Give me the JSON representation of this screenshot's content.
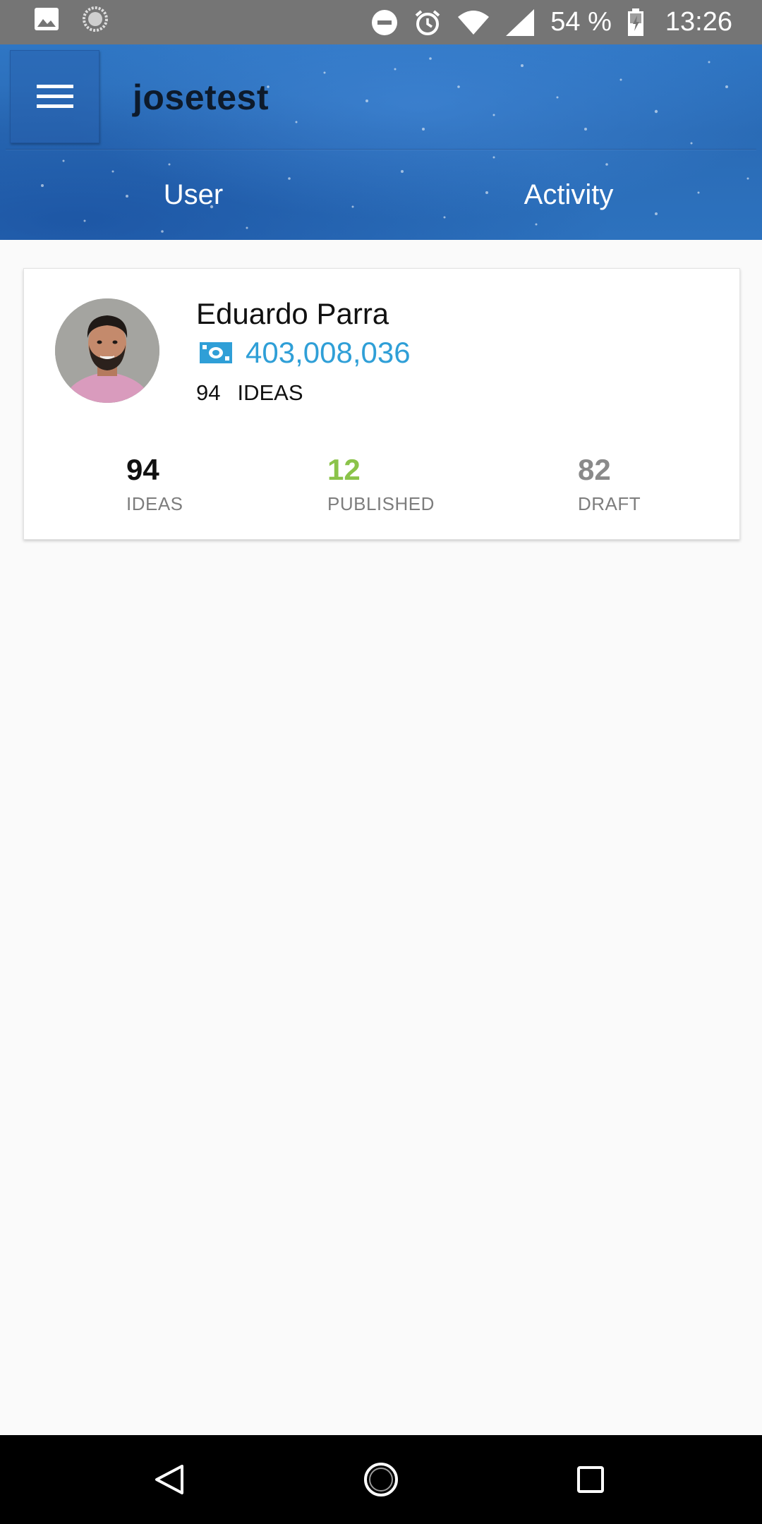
{
  "status_bar": {
    "left_icons": [
      "image-icon",
      "loading-icon"
    ],
    "right_icons": [
      "do-not-disturb-icon",
      "alarm-icon",
      "wifi-icon",
      "signal-icon",
      "battery-icon"
    ],
    "battery_text": "54 %",
    "time": "13:26"
  },
  "header": {
    "menu_icon": "hamburger-menu-icon",
    "title": "josetest",
    "tabs": [
      {
        "label": "User"
      },
      {
        "label": "Activity"
      }
    ]
  },
  "profile": {
    "name": "Eduardo Parra",
    "balance_icon": "money-icon",
    "balance": "403,008,036",
    "ideas_count": "94",
    "ideas_label": "IDEAS",
    "stats": [
      {
        "value": "94",
        "label": "IDEAS",
        "color": "#111111"
      },
      {
        "value": "12",
        "label": "PUBLISHED",
        "color": "#8bc34a"
      },
      {
        "value": "82",
        "label": "DRAFT",
        "color": "#8a8a8a"
      }
    ]
  },
  "colors": {
    "header_blue": "#2d72be",
    "balance_blue": "#2f9fd7",
    "published_green": "#8bc34a",
    "draft_gray": "#8a8a8a"
  },
  "nav_bar": {
    "buttons": [
      "back-icon",
      "home-icon",
      "recents-icon"
    ]
  }
}
